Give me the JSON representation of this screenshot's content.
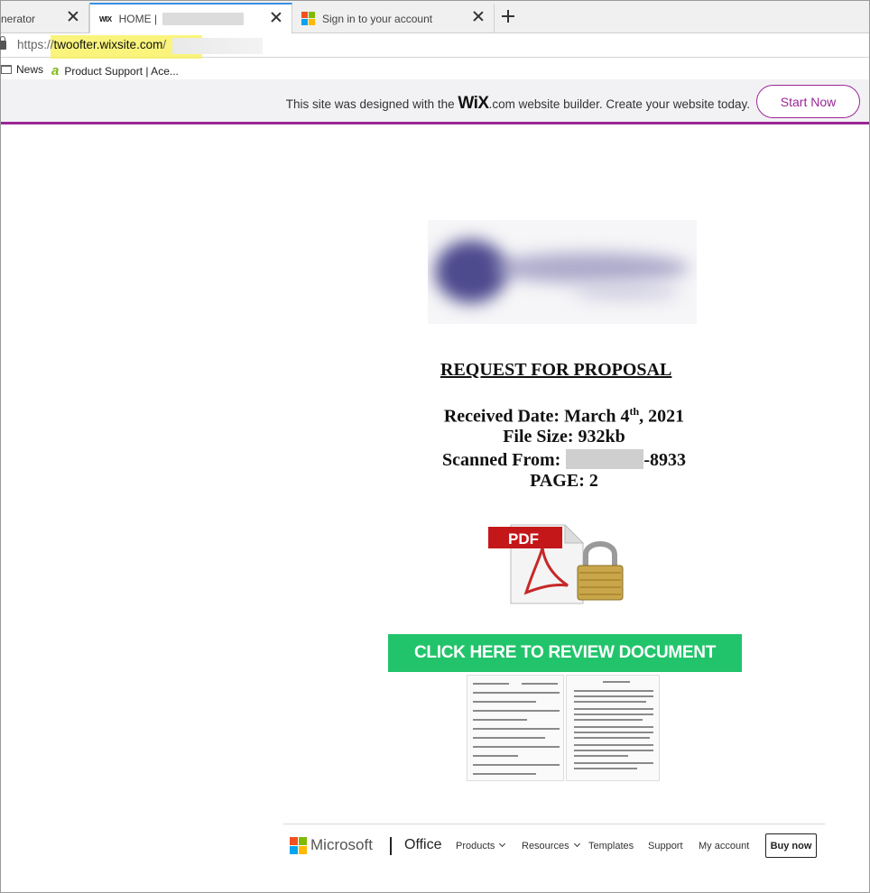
{
  "browser": {
    "tabs": [
      {
        "label": "nerator"
      },
      {
        "label": "HOME |",
        "favicon": "WIX"
      },
      {
        "label": "Sign in to your account"
      }
    ],
    "url": {
      "scheme": "https://",
      "host": "twoofter.wixsite.com",
      "path": "/"
    },
    "bookmarks": [
      {
        "label": "News",
        "icon": "folder-icon"
      },
      {
        "label": "Product Support | Ace...",
        "icon": "acer-icon"
      }
    ]
  },
  "wix_banner": {
    "prefix": "This site was designed with the",
    "logo": "WiX",
    "suffix": ".com website builder. Create your website today.",
    "button": "Start Now",
    "accent": "#9a2796"
  },
  "document": {
    "title": "REQUEST FOR PROPOSAL",
    "received_label": "Received Date:",
    "received_month_day": "March 4",
    "received_sup": "th",
    "received_year": ", 2021",
    "file_size": "File Size:  932kb",
    "scanned_label": "Scanned From:",
    "scanned_suffix": "-8933",
    "page": "PAGE: 2",
    "pdf_label": "PDF",
    "cta": "CLICK HERE TO REVIEW DOCUMENT",
    "cta_color": "#22c46b"
  },
  "footer": {
    "brand": "Microsoft",
    "product": "Office",
    "nav": [
      "Products",
      "Resources",
      "Templates",
      "Support",
      "My account"
    ],
    "buy": "Buy now"
  }
}
